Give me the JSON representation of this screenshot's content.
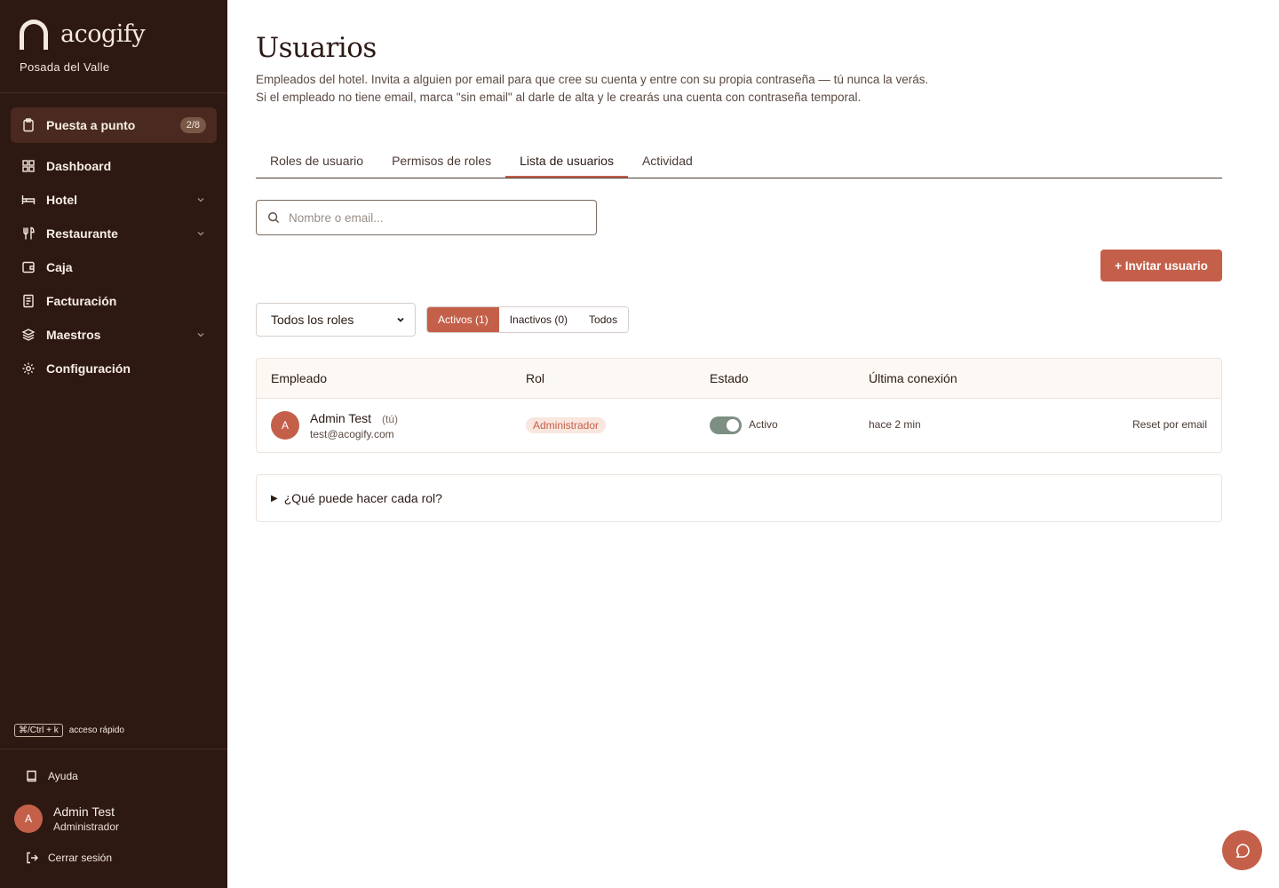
{
  "brand": {
    "name": "acogify",
    "property": "Posada del Valle"
  },
  "setup": {
    "label": "Puesta a punto",
    "progress": "2/8"
  },
  "nav": [
    {
      "label": "Dashboard",
      "icon": "grid-icon",
      "expandable": false
    },
    {
      "label": "Hotel",
      "icon": "bed-icon",
      "expandable": true
    },
    {
      "label": "Restaurante",
      "icon": "utensils-icon",
      "expandable": true
    },
    {
      "label": "Caja",
      "icon": "wallet-icon",
      "expandable": false
    },
    {
      "label": "Facturación",
      "icon": "receipt-icon",
      "expandable": false
    },
    {
      "label": "Maestros",
      "icon": "layers-icon",
      "expandable": true
    },
    {
      "label": "Configuración",
      "icon": "gear-icon",
      "expandable": false
    }
  ],
  "shortcut": {
    "keys": "⌘/Ctrl + k",
    "label": "acceso rápido"
  },
  "footer": {
    "help": "Ayuda",
    "user": {
      "initial": "A",
      "name": "Admin Test",
      "role": "Administrador"
    },
    "logout": "Cerrar sesión"
  },
  "page": {
    "title": "Usuarios",
    "description": "Empleados del hotel. Invita a alguien por email para que cree su cuenta y entre con su propia contraseña — tú nunca la verás. Si el empleado no tiene email, marca \"sin email\" al darle de alta y le crearás una cuenta con contraseña temporal."
  },
  "tabs": [
    {
      "label": "Roles de usuario",
      "active": false
    },
    {
      "label": "Permisos de roles",
      "active": false
    },
    {
      "label": "Lista de usuarios",
      "active": true
    },
    {
      "label": "Actividad",
      "active": false
    }
  ],
  "search": {
    "placeholder": "Nombre o email...",
    "value": ""
  },
  "invite_button": "+ Invitar usuario",
  "filters": {
    "role_select": "Todos los roles",
    "status": [
      {
        "label": "Activos (1)",
        "active": true
      },
      {
        "label": "Inactivos (0)",
        "active": false
      },
      {
        "label": "Todos",
        "active": false
      }
    ]
  },
  "table": {
    "headers": {
      "employee": "Empleado",
      "role": "Rol",
      "status": "Estado",
      "last_login": "Última conexión"
    },
    "rows": [
      {
        "initial": "A",
        "name": "Admin Test",
        "you": "(tú)",
        "email": "test@acogify.com",
        "role": "Administrador",
        "active": true,
        "status": "Activo",
        "last_login": "hace 2 min",
        "action": "Reset por email"
      }
    ]
  },
  "faq": {
    "label": "¿Qué puede hacer cada rol?"
  },
  "colors": {
    "sidebar": "#2e1812",
    "accent": "#c4604a",
    "toggle_on": "#7d8f82"
  }
}
